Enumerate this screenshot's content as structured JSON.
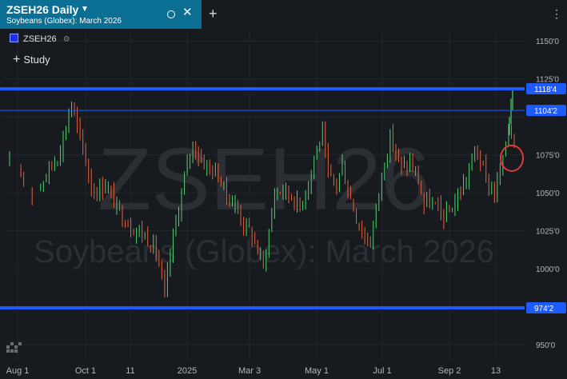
{
  "tab": {
    "title": "ZSEH26 Daily",
    "subtitle": "Soybeans (Globex): March 2026",
    "close_symbol": "✕",
    "new_tab_symbol": "+",
    "more_symbol": "⋮"
  },
  "legend": {
    "symbol": "ZSEH26",
    "color": "#1f2bff"
  },
  "study": {
    "label": "Study"
  },
  "watermark": {
    "symbol": "ZSEH26",
    "description": "Soybeans (Globex): March 2026"
  },
  "colors": {
    "background": "#171a1e",
    "tab": "#0a6f93",
    "up": "#4ed36b",
    "down": "#e8613c",
    "hline": "#1e5bff",
    "annotation": "#e03b3b"
  },
  "chart_data": {
    "type": "ohlc",
    "ylim": [
      940,
      1158
    ],
    "y_ticks": [
      {
        "value": 1150,
        "label": "1150'0"
      },
      {
        "value": 1125,
        "label": "1125'0"
      },
      {
        "value": 1100,
        "label": "1100'0"
      },
      {
        "value": 1075,
        "label": "1075'0"
      },
      {
        "value": 1050,
        "label": "1050'0"
      },
      {
        "value": 1025,
        "label": "1025'0"
      },
      {
        "value": 1000,
        "label": "1000'0"
      },
      {
        "value": 975,
        "label": "975'0"
      },
      {
        "value": 950,
        "label": "950'0"
      }
    ],
    "x_labels": [
      "Aug 1",
      "Oct 1",
      "11",
      "2025",
      "Mar 3",
      "May 1",
      "Jul 1",
      "Sep 2",
      "13"
    ],
    "horizontal_lines": [
      {
        "value": 1118.5,
        "label": "1118'4",
        "style": "thick"
      },
      {
        "value": 1104.25,
        "label": "1104'2",
        "style": "thin"
      },
      {
        "value": 974.25,
        "label": "974'2",
        "style": "thick"
      }
    ],
    "series": {
      "name": "ZSEH26",
      "close_path": [
        [
          0,
          1068
        ],
        [
          4,
          1062
        ],
        [
          8,
          1050
        ],
        [
          11,
          1056
        ],
        [
          14,
          1066
        ],
        [
          17,
          1074
        ],
        [
          19,
          1086
        ],
        [
          21,
          1102
        ],
        [
          22,
          1110
        ],
        [
          23,
          1100
        ],
        [
          25,
          1085
        ],
        [
          26,
          1080
        ],
        [
          28,
          1062
        ],
        [
          30,
          1050
        ],
        [
          34,
          1056
        ],
        [
          38,
          1040
        ],
        [
          43,
          1028
        ],
        [
          48,
          1022
        ],
        [
          52,
          1012
        ],
        [
          54,
          992
        ],
        [
          55,
          980
        ],
        [
          57,
          1010
        ],
        [
          59,
          1030
        ],
        [
          61,
          1050
        ],
        [
          63,
          1068
        ],
        [
          65,
          1082
        ],
        [
          68,
          1072
        ],
        [
          71,
          1066
        ],
        [
          74,
          1062
        ],
        [
          77,
          1048
        ],
        [
          80,
          1042
        ],
        [
          83,
          1030
        ],
        [
          86,
          1022
        ],
        [
          88,
          1012
        ],
        [
          90,
          1002
        ],
        [
          92,
          1024
        ],
        [
          94,
          1050
        ],
        [
          97,
          1052
        ],
        [
          100,
          1048
        ],
        [
          103,
          1040
        ],
        [
          106,
          1058
        ],
        [
          109,
          1080
        ],
        [
          111,
          1088
        ],
        [
          113,
          1060
        ],
        [
          116,
          1056
        ],
        [
          118,
          1068
        ],
        [
          120,
          1052
        ],
        [
          123,
          1034
        ],
        [
          126,
          1020
        ],
        [
          128,
          1018
        ],
        [
          131,
          1050
        ],
        [
          133,
          1072
        ],
        [
          135,
          1085
        ],
        [
          137,
          1078
        ],
        [
          139,
          1065
        ],
        [
          142,
          1070
        ],
        [
          145,
          1058
        ],
        [
          147,
          1042
        ],
        [
          149,
          1044
        ],
        [
          152,
          1038
        ],
        [
          155,
          1034
        ],
        [
          158,
          1044
        ],
        [
          161,
          1055
        ],
        [
          163,
          1065
        ],
        [
          165,
          1078
        ],
        [
          167,
          1072
        ],
        [
          169,
          1058
        ],
        [
          172,
          1050
        ],
        [
          175,
          1070
        ],
        [
          177,
          1096
        ],
        [
          179,
          1084
        ]
      ],
      "bar_count": 180
    },
    "annotation": {
      "type": "ellipse",
      "near_value": 1077,
      "color": "#e03b3b"
    }
  }
}
